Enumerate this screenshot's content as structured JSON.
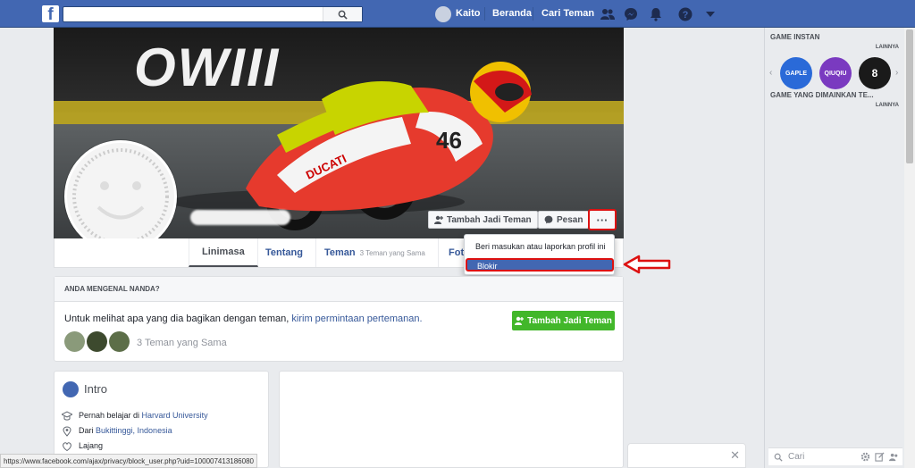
{
  "topbar": {
    "logo": "f",
    "search_placeholder": "",
    "user_name": "Kaito",
    "home_label": "Beranda",
    "find_friends_label": "Cari Teman"
  },
  "profile": {
    "cover_text": "OWIII",
    "add_friend_label": "Tambah Jadi Teman",
    "message_label": "Pesan",
    "more_label": "···"
  },
  "tabs": [
    {
      "label": "Linimasa",
      "sub": ""
    },
    {
      "label": "Tentang",
      "sub": ""
    },
    {
      "label": "Teman",
      "sub": "3 Teman yang Sama"
    },
    {
      "label": "Foto",
      "sub": ""
    }
  ],
  "dropdown": {
    "item_report": "Beri masukan atau laporkan profil ini",
    "item_block": "Blokir"
  },
  "know": {
    "header": "ANDA MENGENAL NANDA?",
    "text": "Untuk melihat apa yang dia bagikan dengan teman, ",
    "link": "kirim permintaan pertemanan.",
    "mutual": "3 Teman yang Sama",
    "add_friend": "Tambah Jadi Teman"
  },
  "intro": {
    "title": "Intro",
    "studied_prefix": "Pernah belajar di ",
    "studied_link": "Harvard University",
    "from_prefix": "Dari ",
    "from_link": "Bukittinggi, Indonesia",
    "relationship": "Lajang"
  },
  "statusbar": {
    "url": "https://www.facebook.com/ajax/privacy/block_user.php?uid=100007413186080"
  },
  "sidebar": {
    "games_title": "GAME INSTAN",
    "more1": "LAINNYA",
    "played_title": "GAME YANG DIMAINKAN TE...",
    "more2": "LAINNYA",
    "games": [
      "GAPLE",
      "QIUQIU",
      "8"
    ],
    "chat_search_placeholder": "Cari"
  },
  "colors": {
    "brand": "#4267b2",
    "green": "#42b72a",
    "highlight": "#dd1111"
  }
}
